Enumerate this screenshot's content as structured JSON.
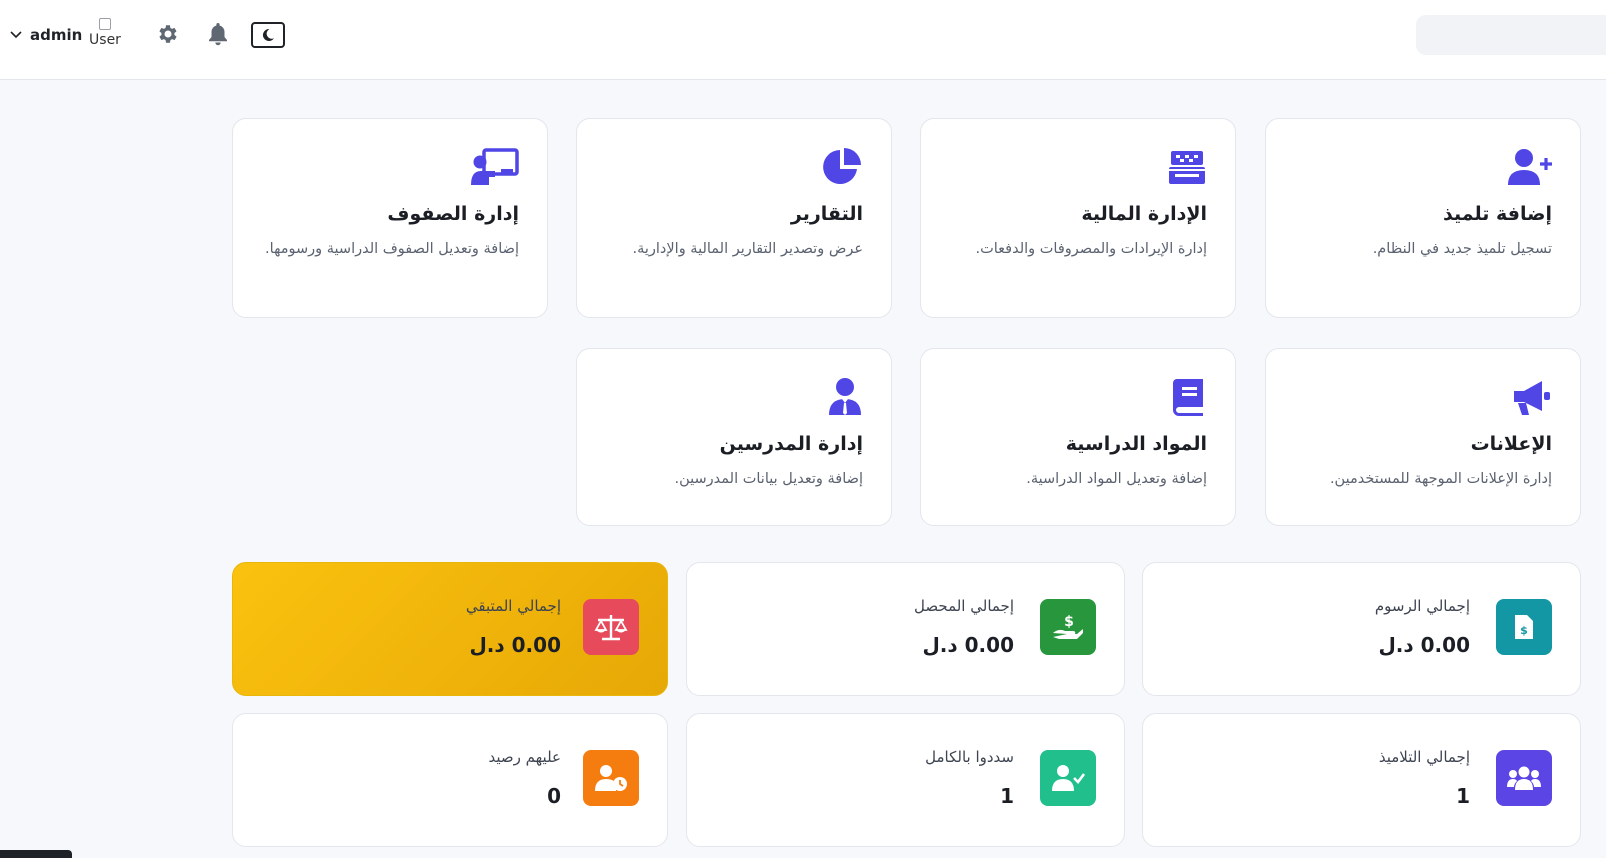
{
  "header": {
    "username": "admin",
    "avatar_alt": "User",
    "search_placeholder": ""
  },
  "icons": {
    "chevron": "chevron-down-icon",
    "settings": "gear-icon",
    "notifications": "bell-icon",
    "theme": "moon-icon"
  },
  "colors": {
    "accent": "#4f46e5",
    "teal": "#1497a5",
    "green": "#27963c",
    "red": "#e64a5b",
    "indigo": "#5b45e4",
    "emerald": "#20bf8c",
    "orange": "#f57d10",
    "yellow": "#fbc20f"
  },
  "features": [
    {
      "title": "إضافة تلميذ",
      "desc": "تسجيل تلميذ جديد في النظام.",
      "icon": "user-plus-icon"
    },
    {
      "title": "الإدارة المالية",
      "desc": "إدارة الإيرادات والمصروفات والدفعات.",
      "icon": "cash-register-icon"
    },
    {
      "title": "التقارير",
      "desc": "عرض وتصدير التقارير المالية والإدارية.",
      "icon": "pie-chart-icon"
    },
    {
      "title": "إدارة الصفوف",
      "desc": "إضافة وتعديل الصفوف الدراسية ورسومها.",
      "icon": "chalkboard-teacher-icon"
    },
    {
      "title": "الإعلانات",
      "desc": "إدارة الإعلانات الموجهة للمستخدمين.",
      "icon": "megaphone-icon"
    },
    {
      "title": "المواد الدراسية",
      "desc": "إضافة وتعديل المواد الدراسية.",
      "icon": "book-icon"
    },
    {
      "title": "إدارة المدرسين",
      "desc": "إضافة وتعديل بيانات المدرسين.",
      "icon": "teacher-icon"
    }
  ],
  "stats": [
    {
      "label": "إجمالي الرسوم",
      "value": "0.00 د.ل",
      "icon": "invoice-dollar-icon"
    },
    {
      "label": "إجمالي المحصل",
      "value": "0.00 د.ل",
      "icon": "hand-dollar-icon"
    },
    {
      "label": "إجمالي المتبقي",
      "value": "0.00 د.ل",
      "icon": "balance-scale-icon"
    },
    {
      "label": "إجمالي التلاميذ",
      "value": "1",
      "icon": "users-icon"
    },
    {
      "label": "سددوا بالكامل",
      "value": "1",
      "icon": "user-check-icon"
    },
    {
      "label": "عليهم رصيد",
      "value": "0",
      "icon": "user-clock-icon"
    }
  ]
}
